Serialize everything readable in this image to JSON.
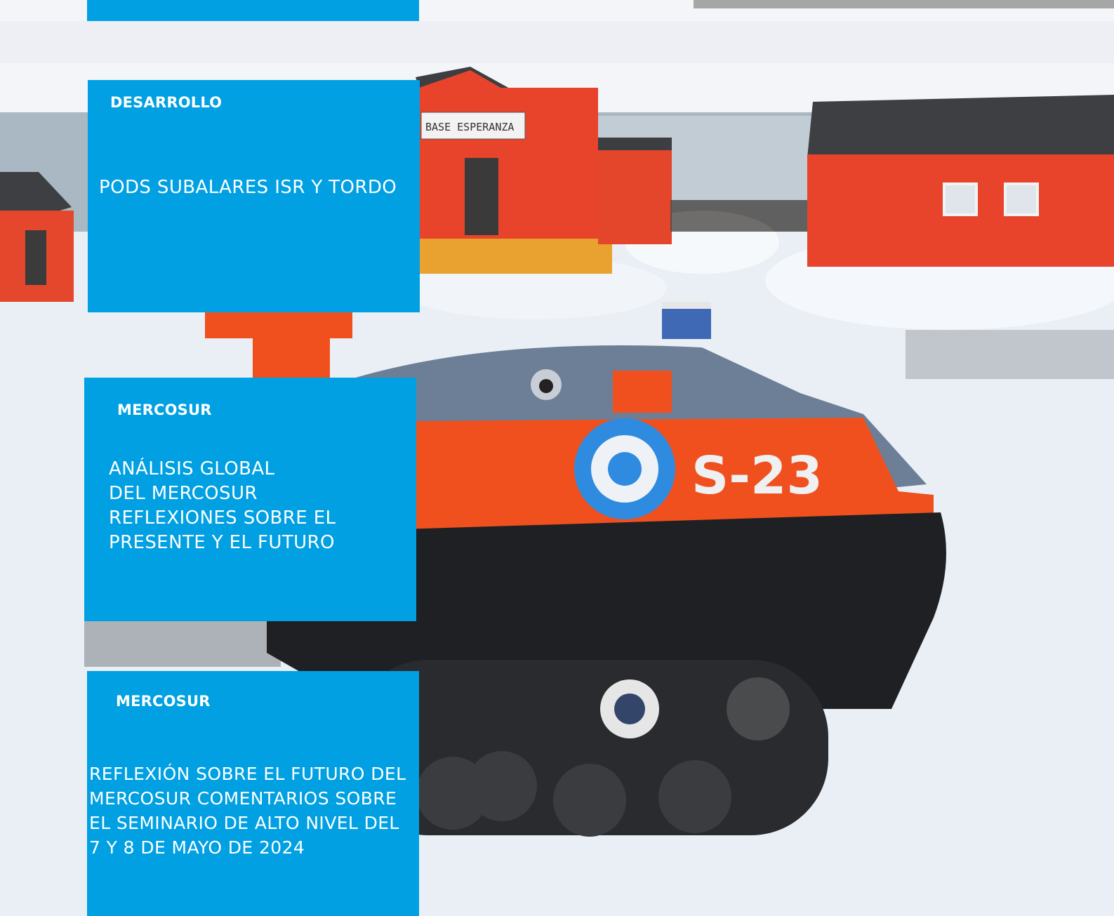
{
  "hero_image": {
    "sign_text": "BASE ESPERANZA",
    "vehicle_marking": "S-23"
  },
  "articles": [
    {
      "category": "DESARROLLO",
      "title": "PODS SUBALARES ISR Y TORDO"
    },
    {
      "category": "MERCOSUR",
      "title": "ANÁLISIS GLOBAL\nDEL MERCOSUR\nREFLEXIONES SOBRE EL\nPRESENTE Y EL FUTURO"
    },
    {
      "category": "MERCOSUR",
      "title": "REFLEXIÓN SOBRE EL FUTURO DEL\nMERCOSUR COMENTARIOS SOBRE\nEL SEMINARIO DE ALTO NIVEL DEL\n7 Y 8 DE MAYO DE 2024"
    }
  ],
  "colors": {
    "card_blue": "#00a0e2",
    "building_orange": "#e8402a",
    "vehicle_orange": "#f0501e",
    "snow": "#eef3f8",
    "sky": "#f4f6f9",
    "sea": "#9fb0bd"
  }
}
